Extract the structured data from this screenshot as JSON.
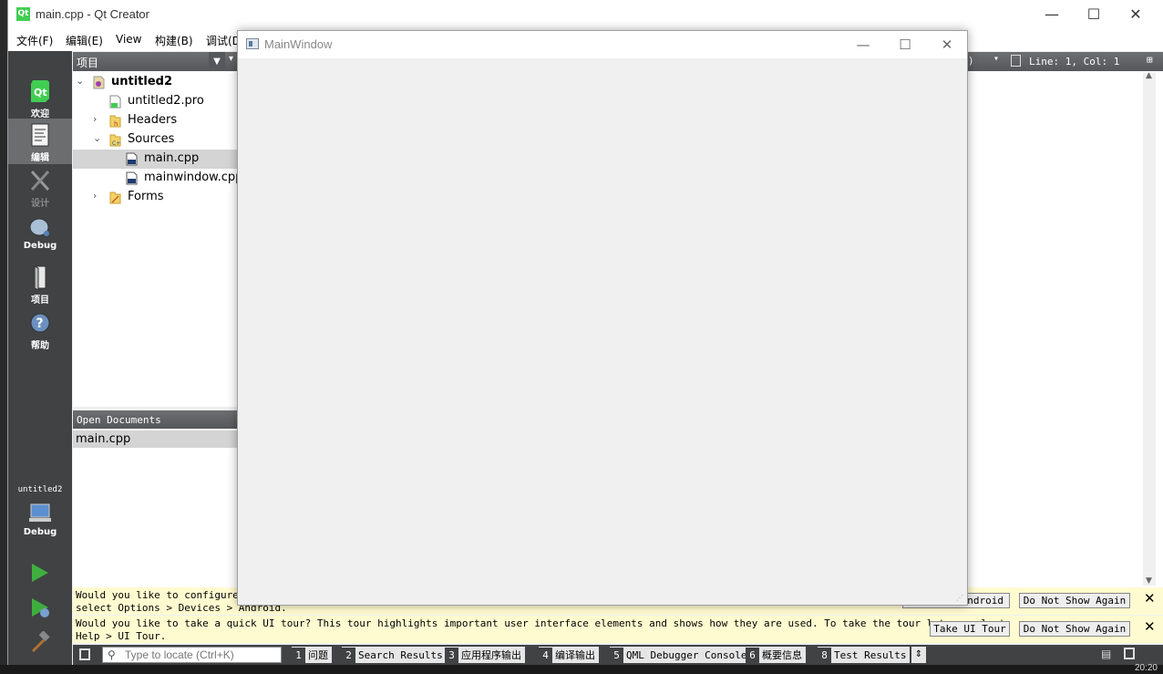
{
  "app": {
    "title": "main.cpp - Qt Creator",
    "logo": "Qt",
    "controls": {
      "minimize": "—",
      "maximize": "☐",
      "close": "✕"
    }
  },
  "menubar": [
    "文件(F)",
    "编辑(E)",
    "View",
    "构建(B)",
    "调试(D"
  ],
  "modes": [
    {
      "label": "欢迎",
      "icon": "qt-welcome-icon"
    },
    {
      "label": "编辑",
      "icon": "edit-document-icon"
    },
    {
      "label": "设计",
      "icon": "design-tools-icon"
    },
    {
      "label": "Debug",
      "icon": "debug-bug-icon"
    },
    {
      "label": "项目",
      "icon": "project-book-icon"
    },
    {
      "label": "帮助",
      "icon": "help-question-icon"
    }
  ],
  "kit": {
    "project": "untitled2",
    "config": "Debug"
  },
  "sidebar": {
    "header": "项目",
    "tree": [
      {
        "label": "untitled2",
        "depth": 0,
        "arrow": "⌄",
        "bold": true,
        "icon": "qt-project-icon"
      },
      {
        "label": "untitled2.pro",
        "depth": 1,
        "arrow": "",
        "icon": "pro-file-icon"
      },
      {
        "label": "Headers",
        "depth": 1,
        "arrow": "›",
        "icon": "headers-folder-icon"
      },
      {
        "label": "Sources",
        "depth": 1,
        "arrow": "⌄",
        "icon": "sources-folder-icon"
      },
      {
        "label": "main.cpp",
        "depth": 2,
        "arrow": "",
        "icon": "cpp-file-icon",
        "selected": true
      },
      {
        "label": "mainwindow.cpp",
        "depth": 2,
        "arrow": "",
        "icon": "cpp-file-icon"
      },
      {
        "label": "Forms",
        "depth": 1,
        "arrow": "›",
        "icon": "forms-folder-icon"
      }
    ]
  },
  "open_documents": {
    "header": "Open Documents",
    "items": [
      "main.cpp"
    ]
  },
  "editor": {
    "position": "Line: 1, Col: 1",
    "selector": ")"
  },
  "infobars": [
    {
      "text": "Would you like to configure Ar",
      "text2": "select Options > Devices > Android.",
      "buttons": [
        "Android",
        "Do Not Show Again"
      ]
    },
    {
      "text": "Would you like to take a quick UI tour? This tour highlights important user interface elements and shows how they are used. To take the tour later, select",
      "text2": "Help > UI Tour.",
      "buttons": [
        "Take UI Tour",
        "Do Not Show Again"
      ]
    }
  ],
  "statusbar": {
    "locator_placeholder": "Type to locate (Ctrl+K)",
    "panes": [
      {
        "n": "1",
        "label": "问题"
      },
      {
        "n": "2",
        "label": "Search Results"
      },
      {
        "n": "3",
        "label": "应用程序输出"
      },
      {
        "n": "4",
        "label": "编译输出"
      },
      {
        "n": "5",
        "label": "QML Debugger Console"
      },
      {
        "n": "6",
        "label": "概要信息"
      },
      {
        "n": "8",
        "label": "Test Results"
      }
    ]
  },
  "mainwindow": {
    "title": "MainWindow"
  },
  "clock": "20:20"
}
